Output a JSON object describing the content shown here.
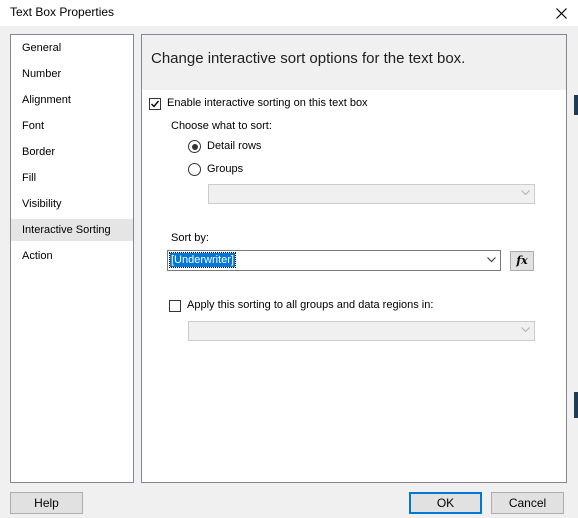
{
  "dialog": {
    "title": "Text Box Properties",
    "close_icon": "close-icon"
  },
  "nav": {
    "items": [
      {
        "label": "General"
      },
      {
        "label": "Number"
      },
      {
        "label": "Alignment"
      },
      {
        "label": "Font"
      },
      {
        "label": "Border"
      },
      {
        "label": "Fill"
      },
      {
        "label": "Visibility"
      },
      {
        "label": "Interactive Sorting"
      },
      {
        "label": "Action"
      }
    ],
    "selected": "Interactive Sorting"
  },
  "panel": {
    "title": "Change interactive sort options for the text box.",
    "enable_label": "Enable interactive sorting on this text box",
    "enable_checked": true,
    "choose_label": "Choose what to sort:",
    "option_detail": "Detail rows",
    "option_groups": "Groups",
    "selected_option": "Detail rows",
    "groups_combo_value": "",
    "sort_by_label": "Sort by:",
    "sort_by_value": "[Underwriter]",
    "fx_label": "fx",
    "apply_label": "Apply this sorting to all groups and data regions in:",
    "apply_checked": false,
    "apply_combo_value": ""
  },
  "buttons": {
    "help": "Help",
    "ok": "OK",
    "cancel": "Cancel"
  },
  "colors": {
    "accent": "#0078d7",
    "selected_nav": "#e5e5e5",
    "header_bg": "#f0f0f0"
  }
}
